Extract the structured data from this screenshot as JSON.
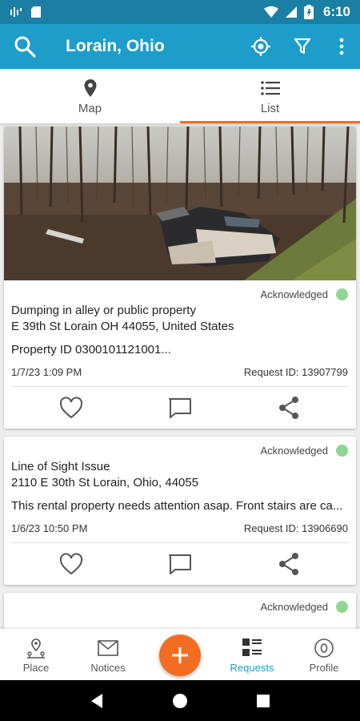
{
  "status_bar": {
    "time": "6:10"
  },
  "header": {
    "title": "Lorain, Ohio"
  },
  "tabs": [
    {
      "label": "Map",
      "icon": "location-pin-icon"
    },
    {
      "label": "List",
      "icon": "list-icon",
      "active": true
    }
  ],
  "requests": [
    {
      "status": "Acknowledged",
      "status_color": "#8fd694",
      "title": "Dumping in alley or public property",
      "address": "E 39th St Lorain OH 44055, United States",
      "description": "Property ID 0300101121001...",
      "date": "1/7/23 1:09 PM",
      "request_id": "Request ID: 13907799",
      "has_photo": true
    },
    {
      "status": "Acknowledged",
      "status_color": "#8fd694",
      "title": "Line of Sight Issue",
      "address": "2110 E 30th St Lorain, Ohio, 44055",
      "description": "This rental property needs attention asap. Front stairs are ca...",
      "date": "1/6/23 10:50 PM",
      "request_id": "Request ID: 13906690",
      "has_photo": false
    },
    {
      "status": "Acknowledged",
      "status_color": "#8fd694"
    }
  ],
  "bottom_nav": [
    {
      "label": "Place",
      "icon": "place-icon"
    },
    {
      "label": "Notices",
      "icon": "mail-icon"
    },
    {
      "label": "Requests",
      "icon": "requests-icon",
      "active": true
    },
    {
      "label": "Profile",
      "icon": "profile-icon"
    }
  ],
  "colors": {
    "primary": "#1e9dcb",
    "status_bar": "#1a7fa3",
    "accent": "#f26d21",
    "acknowledged": "#8fd694"
  }
}
